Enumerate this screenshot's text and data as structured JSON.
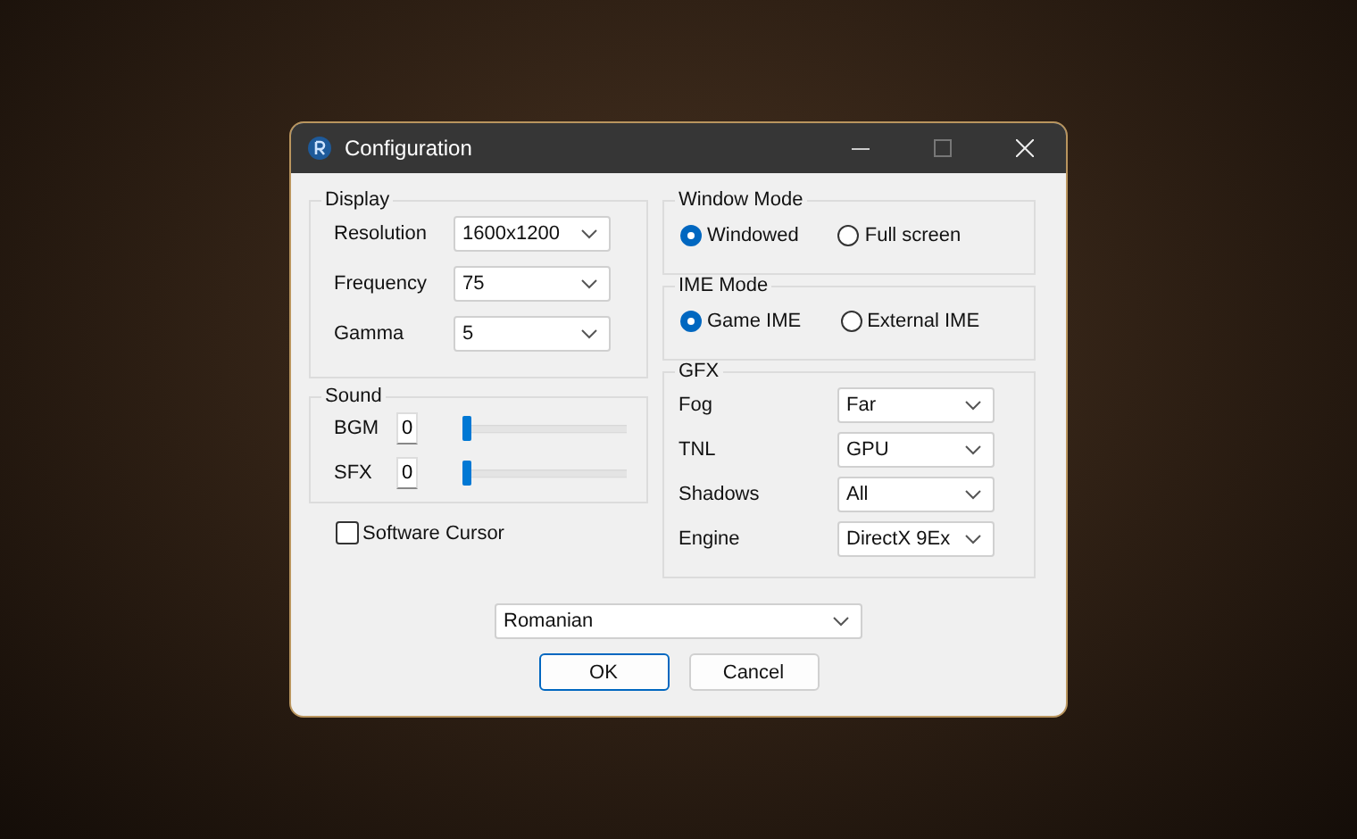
{
  "window": {
    "title": "Configuration"
  },
  "display": {
    "title": "Display",
    "fields": [
      {
        "label": "Resolution",
        "value": "1600x1200"
      },
      {
        "label": "Frequency",
        "value": "75"
      },
      {
        "label": "Gamma",
        "value": "5"
      }
    ]
  },
  "sound": {
    "title": "Sound",
    "channels": [
      {
        "label": "BGM",
        "value": "0",
        "level": 0
      },
      {
        "label": "SFX",
        "value": "0",
        "level": 0
      }
    ]
  },
  "software_cursor": {
    "label": "Software Cursor",
    "checked": false
  },
  "window_mode": {
    "title": "Window Mode",
    "options": [
      {
        "label": "Windowed",
        "selected": true
      },
      {
        "label": "Full screen",
        "selected": false
      }
    ]
  },
  "ime_mode": {
    "title": "IME Mode",
    "options": [
      {
        "label": "Game IME",
        "selected": true
      },
      {
        "label": "External IME",
        "selected": false
      }
    ]
  },
  "gfx": {
    "title": "GFX",
    "fields": [
      {
        "label": "Fog",
        "value": "Far"
      },
      {
        "label": "TNL",
        "value": "GPU"
      },
      {
        "label": "Shadows",
        "value": "All"
      },
      {
        "label": "Engine",
        "value": "DirectX 9Ex"
      }
    ]
  },
  "language": {
    "value": "Romanian"
  },
  "buttons": [
    {
      "label": "OK",
      "kind": "default"
    },
    {
      "label": "Cancel",
      "kind": "normal"
    }
  ]
}
